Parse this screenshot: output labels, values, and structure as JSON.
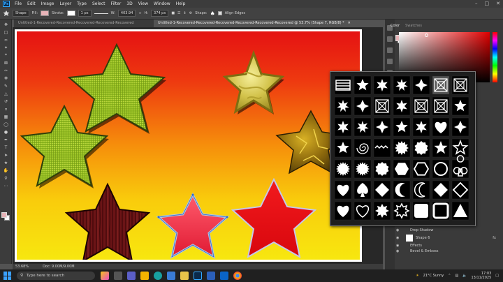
{
  "menu": {
    "logo": "Ps",
    "items": [
      "File",
      "Edit",
      "Image",
      "Layer",
      "Type",
      "Select",
      "Filter",
      "3D",
      "View",
      "Window",
      "Help"
    ]
  },
  "options": {
    "mode": "Shape",
    "fill_label": "Fill:",
    "stroke_label": "Stroke:",
    "stroke_width": "1 px",
    "w_label": "W:",
    "w_value": "403.94",
    "h_label": "H:",
    "h_value": "374 px",
    "shape_label": "Shape:",
    "align_edges": "Align Edges",
    "fill_color": "#e7b4b8"
  },
  "tabs": [
    {
      "label": "Untitled-1-Recovered-Recovered-Recovered-Recovered-Recovered",
      "active": false
    },
    {
      "label": "Untitled-1-Recovered-Recovered-Recovered-Recovered-Recovered-Recovered @ 53.7% (Shape 7, RGB/8) *",
      "active": true
    }
  ],
  "status": {
    "zoom": "53.68%",
    "doc": "Doc: 9.00M/9.00M"
  },
  "panels": {
    "color_tab": "Color",
    "swatches_tab": "Swatches"
  },
  "layers": [
    {
      "name": "Gradient Overlay",
      "kind": "effect"
    },
    {
      "name": "Drop Shadow",
      "kind": "effect"
    },
    {
      "name": "Shape 6",
      "kind": "layer",
      "badge": "fx"
    },
    {
      "name": "Effects",
      "kind": "effect"
    },
    {
      "name": "Bevel & Emboss",
      "kind": "effect"
    }
  ],
  "taskbar": {
    "search_placeholder": "Type here to search",
    "weather": "21°C  Sunny",
    "time": "17:03",
    "date": "13/11/2025"
  },
  "colors": {
    "accent": "#31a8ff",
    "canvas_top": "#e51212",
    "canvas_bottom": "#f7e70f"
  }
}
